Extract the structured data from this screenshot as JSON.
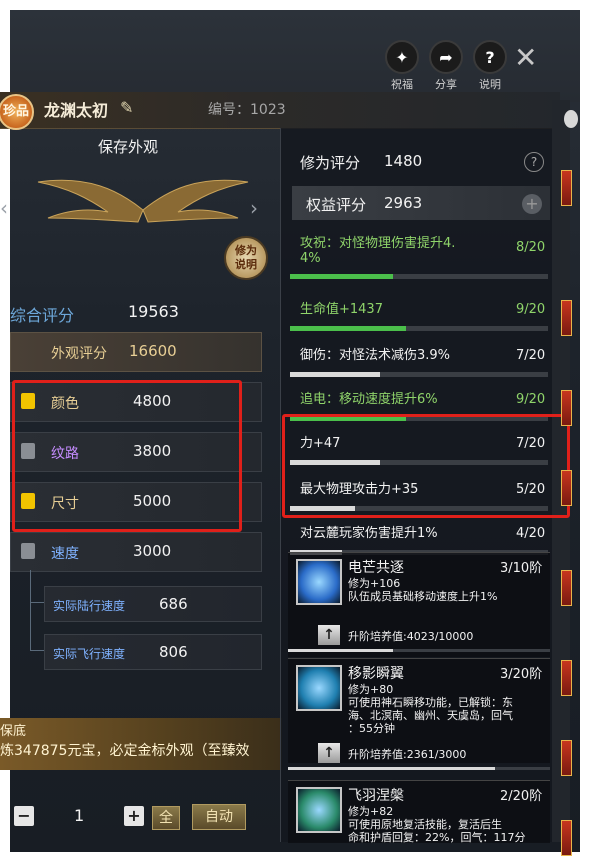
{
  "header": {
    "rarity_badge": "珍品",
    "name": "龙渊太初",
    "serial": "编号：1023",
    "icons": [
      {
        "name": "blessing-icon",
        "label": "祝福"
      },
      {
        "name": "share-icon",
        "label": "分享"
      },
      {
        "name": "help-icon",
        "label": "说明"
      }
    ]
  },
  "left": {
    "save_title": "保存外观",
    "explain_badge": "修为说明",
    "score_label": "综合评分",
    "score_value": "19563",
    "appearance": {
      "label": "外观评分",
      "value": "16600"
    },
    "attributes": [
      {
        "label": "颜色",
        "value": "4800",
        "locked": true
      },
      {
        "label": "纹路",
        "value": "3800",
        "locked": false
      },
      {
        "label": "尺寸",
        "value": "5000",
        "locked": true
      },
      {
        "label": "速度",
        "value": "3000",
        "locked": false
      }
    ],
    "speed_sub": [
      {
        "label": "实际陆行速度",
        "value": "686"
      },
      {
        "label": "实际飞行速度",
        "value": "806"
      }
    ],
    "banner_title": "保底",
    "banner_text": "炼347875元宝，必定金标外观（至臻效",
    "quantity": "1",
    "all_label": "全",
    "auto_label": "自动"
  },
  "right": {
    "cultivation_label": "修为评分",
    "cultivation_value": "1480",
    "equity_label": "权益评分",
    "equity_value": "2963",
    "stats": [
      {
        "text": "攻祝：对怪物理伤害提升4.\n4%",
        "level": "8/20",
        "color": "#8fd46a",
        "fill": 0.4,
        "fillColor": "#4bbf4b"
      },
      {
        "text": "生命值+1437",
        "level": "9/20",
        "color": "#8fd46a",
        "fill": 0.45,
        "fillColor": "#4bbf4b"
      },
      {
        "text": "御伤：对怪法术减伤3.9%",
        "level": "7/20",
        "color": "#f2f2f2",
        "fill": 0.35,
        "fillColor": "#d9d9d9"
      },
      {
        "text": "追电：移动速度提升6%",
        "level": "9/20",
        "color": "#8fd46a",
        "fill": 0.45,
        "fillColor": "#4bbf4b"
      },
      {
        "text": "力+47",
        "level": "7/20",
        "color": "#f2f2f2",
        "fill": 0.35,
        "fillColor": "#d9d9d9"
      },
      {
        "text": "最大物理攻击力+35",
        "level": "5/20",
        "color": "#f2f2f2",
        "fill": 0.25,
        "fillColor": "#d9d9d9"
      },
      {
        "text": "对云麓玩家伤害提升1%",
        "level": "4/20",
        "color": "#f2f2f2",
        "fill": 0.2,
        "fillColor": "#d9d9d9"
      }
    ],
    "skills": [
      {
        "name": "电芒共逐",
        "rank": "3/10阶",
        "desc": [
          "修为+106",
          "队伍成员基础移动速度上升1%"
        ],
        "upgrade": "升阶培养值:4023/10000",
        "progress": 0.4
      },
      {
        "name": "移影瞬翼",
        "rank": "3/20阶",
        "desc": [
          "修为+80",
          "可使用神石瞬移功能，已解锁：东",
          "海、北溟南、幽州、天虞岛，回气",
          "：55分钟"
        ],
        "upgrade": "升阶培养值:2361/3000",
        "progress": 0.79
      },
      {
        "name": "飞羽涅槃",
        "rank": "2/20阶",
        "desc": [
          "修为+82",
          "可使用原地复活技能，复活后生",
          "命和护盾回复：22%，回气：117分"
        ],
        "upgrade": "",
        "progress": 0
      }
    ]
  },
  "colors": {
    "accent_gold": "#e8cf95",
    "annotation_red": "#e0201a",
    "score_blue": "#6da7d9"
  }
}
